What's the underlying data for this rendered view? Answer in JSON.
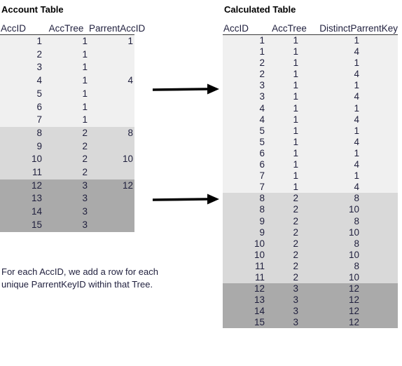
{
  "account_table": {
    "title": "Account Table",
    "columns": [
      "AccID",
      "AccTree",
      "ParrentAccID"
    ],
    "rows": [
      {
        "acc_id": "1",
        "acc_tree": "1",
        "parrent_acc_id": "1",
        "group": 1
      },
      {
        "acc_id": "2",
        "acc_tree": "1",
        "parrent_acc_id": "",
        "group": 1
      },
      {
        "acc_id": "3",
        "acc_tree": "1",
        "parrent_acc_id": "",
        "group": 1
      },
      {
        "acc_id": "4",
        "acc_tree": "1",
        "parrent_acc_id": "4",
        "group": 1
      },
      {
        "acc_id": "5",
        "acc_tree": "1",
        "parrent_acc_id": "",
        "group": 1
      },
      {
        "acc_id": "6",
        "acc_tree": "1",
        "parrent_acc_id": "",
        "group": 1
      },
      {
        "acc_id": "7",
        "acc_tree": "1",
        "parrent_acc_id": "",
        "group": 1
      },
      {
        "acc_id": "8",
        "acc_tree": "2",
        "parrent_acc_id": "8",
        "group": 2
      },
      {
        "acc_id": "9",
        "acc_tree": "2",
        "parrent_acc_id": "",
        "group": 2
      },
      {
        "acc_id": "10",
        "acc_tree": "2",
        "parrent_acc_id": "10",
        "group": 2
      },
      {
        "acc_id": "11",
        "acc_tree": "2",
        "parrent_acc_id": "",
        "group": 2
      },
      {
        "acc_id": "12",
        "acc_tree": "3",
        "parrent_acc_id": "12",
        "group": 3
      },
      {
        "acc_id": "13",
        "acc_tree": "3",
        "parrent_acc_id": "",
        "group": 3
      },
      {
        "acc_id": "14",
        "acc_tree": "3",
        "parrent_acc_id": "",
        "group": 3
      },
      {
        "acc_id": "15",
        "acc_tree": "3",
        "parrent_acc_id": "",
        "group": 3
      }
    ]
  },
  "calculated_table": {
    "title": "Calculated Table",
    "columns": [
      "AccID",
      "AccTree",
      "DistinctParrentKey"
    ],
    "rows": [
      {
        "acc_id": "1",
        "acc_tree": "1",
        "distinct_parrent_key": "1",
        "group": 1
      },
      {
        "acc_id": "1",
        "acc_tree": "1",
        "distinct_parrent_key": "4",
        "group": 1
      },
      {
        "acc_id": "2",
        "acc_tree": "1",
        "distinct_parrent_key": "1",
        "group": 1
      },
      {
        "acc_id": "2",
        "acc_tree": "1",
        "distinct_parrent_key": "4",
        "group": 1
      },
      {
        "acc_id": "3",
        "acc_tree": "1",
        "distinct_parrent_key": "1",
        "group": 1
      },
      {
        "acc_id": "3",
        "acc_tree": "1",
        "distinct_parrent_key": "4",
        "group": 1
      },
      {
        "acc_id": "4",
        "acc_tree": "1",
        "distinct_parrent_key": "1",
        "group": 1
      },
      {
        "acc_id": "4",
        "acc_tree": "1",
        "distinct_parrent_key": "4",
        "group": 1
      },
      {
        "acc_id": "5",
        "acc_tree": "1",
        "distinct_parrent_key": "1",
        "group": 1
      },
      {
        "acc_id": "5",
        "acc_tree": "1",
        "distinct_parrent_key": "4",
        "group": 1
      },
      {
        "acc_id": "6",
        "acc_tree": "1",
        "distinct_parrent_key": "1",
        "group": 1
      },
      {
        "acc_id": "6",
        "acc_tree": "1",
        "distinct_parrent_key": "4",
        "group": 1
      },
      {
        "acc_id": "7",
        "acc_tree": "1",
        "distinct_parrent_key": "1",
        "group": 1
      },
      {
        "acc_id": "7",
        "acc_tree": "1",
        "distinct_parrent_key": "4",
        "group": 1
      },
      {
        "acc_id": "8",
        "acc_tree": "2",
        "distinct_parrent_key": "8",
        "group": 2
      },
      {
        "acc_id": "8",
        "acc_tree": "2",
        "distinct_parrent_key": "10",
        "group": 2
      },
      {
        "acc_id": "9",
        "acc_tree": "2",
        "distinct_parrent_key": "8",
        "group": 2
      },
      {
        "acc_id": "9",
        "acc_tree": "2",
        "distinct_parrent_key": "10",
        "group": 2
      },
      {
        "acc_id": "10",
        "acc_tree": "2",
        "distinct_parrent_key": "8",
        "group": 2
      },
      {
        "acc_id": "10",
        "acc_tree": "2",
        "distinct_parrent_key": "10",
        "group": 2
      },
      {
        "acc_id": "11",
        "acc_tree": "2",
        "distinct_parrent_key": "8",
        "group": 2
      },
      {
        "acc_id": "11",
        "acc_tree": "2",
        "distinct_parrent_key": "10",
        "group": 2
      },
      {
        "acc_id": "12",
        "acc_tree": "3",
        "distinct_parrent_key": "12",
        "group": 3
      },
      {
        "acc_id": "13",
        "acc_tree": "3",
        "distinct_parrent_key": "12",
        "group": 3
      },
      {
        "acc_id": "14",
        "acc_tree": "3",
        "distinct_parrent_key": "12",
        "group": 3
      },
      {
        "acc_id": "15",
        "acc_tree": "3",
        "distinct_parrent_key": "12",
        "group": 3
      }
    ]
  },
  "arrows": [
    {
      "name": "arrow-tree1",
      "label": ""
    },
    {
      "name": "arrow-tree2",
      "label": ""
    }
  ],
  "caption": {
    "text": "For each AccID, we add a row for each unique ParrentKeyID within that Tree."
  },
  "colors": {
    "group1_shade": "#f0f0f0",
    "group2_shade": "#d9d9d9",
    "group3_shade": "#aaaaaa",
    "text": "#1f1f3d",
    "arrow": "#000000",
    "background": "#ffffff"
  }
}
